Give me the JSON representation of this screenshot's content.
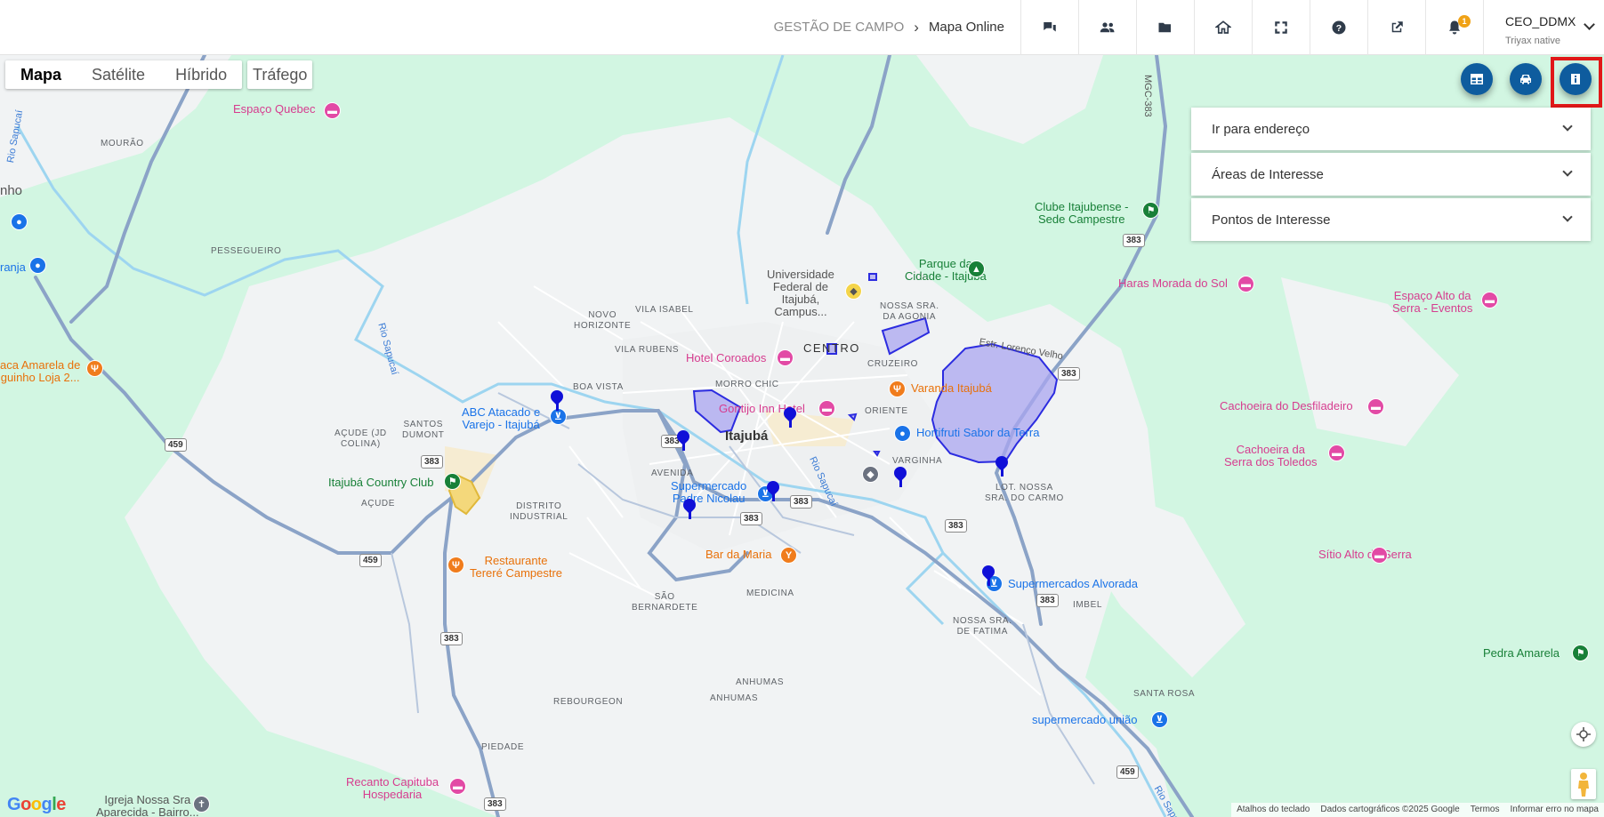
{
  "header": {
    "breadcrumb": {
      "section": "GESTÃO DE CAMPO",
      "separator": "›",
      "page": "Mapa Online"
    },
    "icons": [
      "chat-icon",
      "team-icon",
      "folder-icon",
      "home-icon",
      "fullscreen-icon",
      "help-icon",
      "external-link-icon",
      "bell-icon"
    ],
    "notification_count": "1",
    "user": {
      "name": "CEO_DDMX",
      "subtitle": "Triyax native"
    }
  },
  "map": {
    "map_types": [
      "Mapa",
      "Satélite",
      "Híbrido"
    ],
    "map_type_active": "Mapa",
    "traffic_label": "Tráfego",
    "fab_buttons": [
      "table-icon",
      "car-icon",
      "info-icon"
    ],
    "panels": [
      "Ir para endereço",
      "Áreas de Interesse",
      "Pontos de Interesse"
    ],
    "town_label": "Itajubá",
    "centro_label": "CENTRO",
    "places": {
      "mourao": "MOURÃO",
      "pesseguiro": "PESSEGUEIRO",
      "novo_horizonte": "NOVO\nHORIZONTE",
      "vila_isabel": "VILA ISABEL",
      "vila_rubens": "VILA RUBENS",
      "boa_vista": "BOA VISTA",
      "morro_chic": "MORRO CHIC",
      "santos_dumont": "SANTOS\nDUMONT",
      "acude_colina": "AÇUDE (JD\nCOLINA)",
      "acude": "AÇUDE",
      "avenida": "AVENIDA",
      "distrito_industrial": "DISTRITO\nINDUSTRIAL",
      "oriente": "ORIENTE",
      "varginha": "VARGINHA",
      "cruzeiro": "CRUZEIRO",
      "nossa_sra_agonia": "NOSSA SRA.\nDA AGONIA",
      "lot_nossa_sra_carmo": "LOT. NOSSA\nSRA. DO CARMO",
      "sao_bernardete": "SÃO\nBERNARDETE",
      "medicina": "MEDICINA",
      "nossa_sra_fatima": "NOSSA SRA.\nDE FATIMA",
      "imbel": "IMBEL",
      "anhumas_1": "ANHUMAS",
      "anhumas_2": "ANHUMAS",
      "rebourgeon": "REBOURGEON",
      "piedade": "PIEDADE",
      "santa_rosa": "SANTA ROSA",
      "nho": "nho",
      "ranja": "ranja"
    },
    "pois": {
      "espaco_quebec": "Espaço Quebec",
      "clube_itajubense": "Clube Itajubense -\nSede Campestre",
      "parque_cidade": "Parque da\nCidade - Itajubá",
      "universidade": "Universidade\nFederal de\nItajubá,\nCampus...",
      "haras": "Haras Morada do Sol",
      "espaco_alto_serra": "Espaço Alto da\nSerra - Eventos",
      "hotel_coroados": "Hotel Coroados",
      "varanda_itajuba": "Varanda Itajubá",
      "hortifruti": "Hortifruti Sabor da Terra",
      "abc_atacado": "ABC Atacado e\nVarejo - Itajubá",
      "gontijo": "Gontijo Inn Hotel",
      "itajuba_country": "Itajubá Country Club",
      "supermercado_padre": "Supermercado\nPadre Nicolau",
      "cachoeira_desfiladeiro": "Cachoeira do Desfiladeiro",
      "cachoeira_toledos": "Cachoeira da\nSerra dos Toledos",
      "restaurante_terere": "Restaurante\nTereré Campestre",
      "bar_da_maria": "Bar da Maria",
      "sitio_alto": "Sítio Alto da Serra",
      "supermercados_alvorada": "Supermercados Alvorada",
      "pedra_amarela": "Pedra Amarela",
      "supermercado_uniao": "supermercado união",
      "recanto_capituba": "Recanto Capituba\nHospedaria",
      "igreja": "Igreja Nossa Sra\nAparecida - Bairro...",
      "casa_amarela": "aca Amarela de\nguinho Loja 2..."
    },
    "road_labels": {
      "estr_velho": "Estr. Lorenço Velho",
      "mgc383": "MGC-383"
    },
    "rivers": {
      "rio_sapucai": "Rio Sapucaí"
    },
    "shields": {
      "s459": "459",
      "s383": "383"
    },
    "footer": [
      "Atalhos do teclado",
      "Dados cartográficos ©2025 Google",
      "Termos",
      "Informar erro no mapa"
    ],
    "google_logo": "Google"
  },
  "colors": {
    "map_green": "#d2f6e2",
    "urban": "#f1f3f4",
    "road": "#8ba3c7",
    "river": "#9dd5f0",
    "area_fill": "#a9a6f0",
    "marker_blue": "#1010d8",
    "fab_blue": "#0e5c9e",
    "highlight_red": "#e01818"
  }
}
